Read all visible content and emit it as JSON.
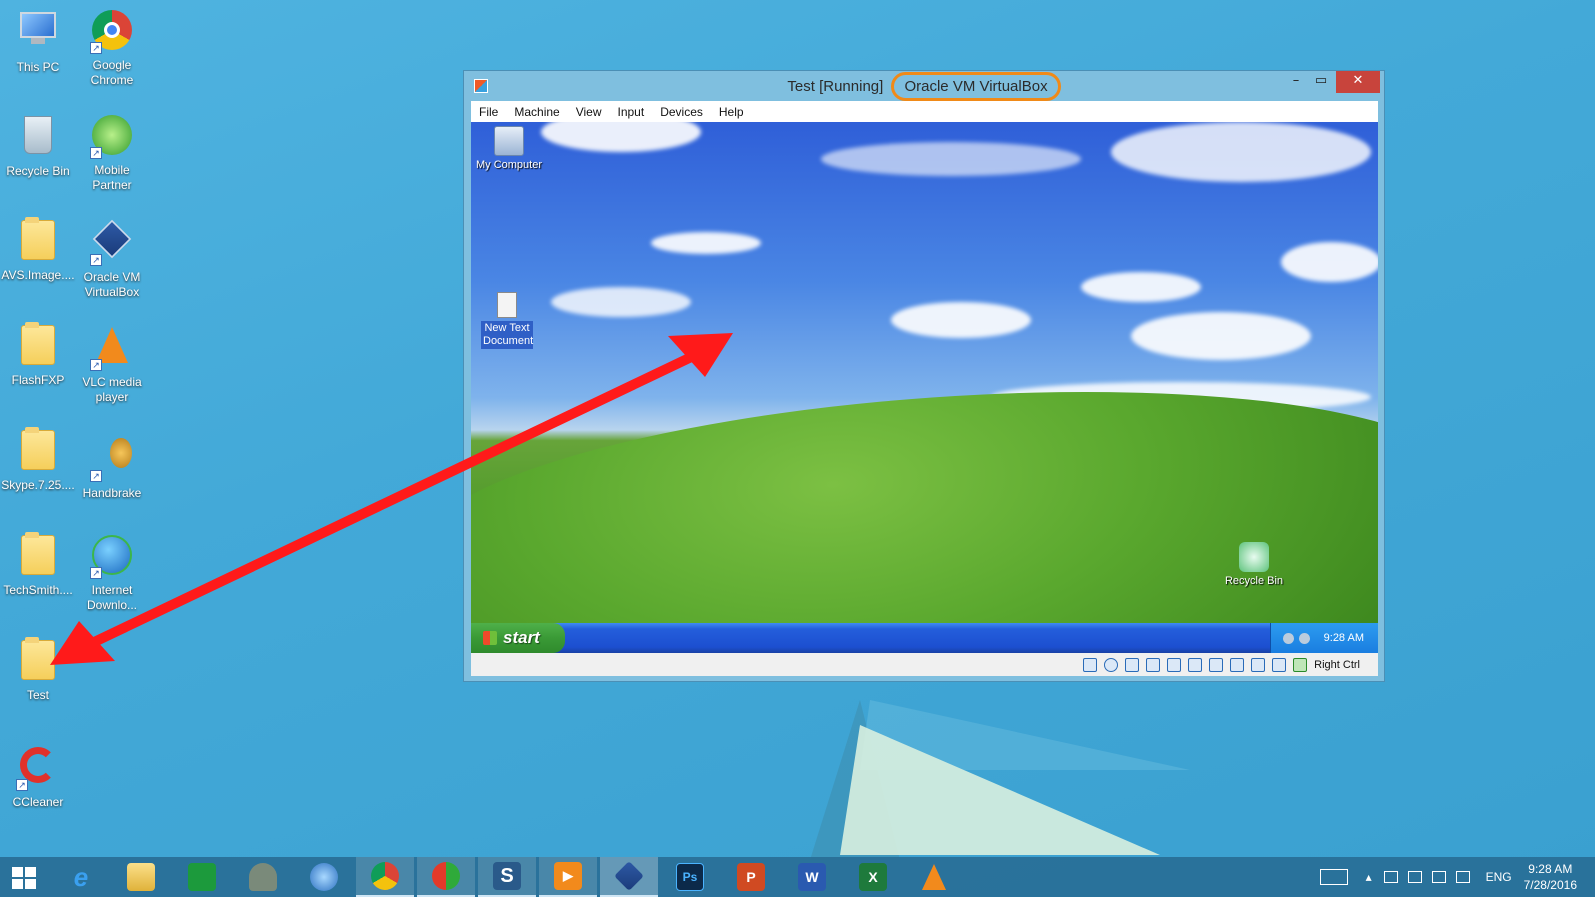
{
  "desktop": {
    "icons": [
      {
        "label": "This PC"
      },
      {
        "label": "Google Chrome"
      },
      {
        "label": "Recycle Bin"
      },
      {
        "label": "Mobile Partner"
      },
      {
        "label": "AVS.Image...."
      },
      {
        "label": "Oracle VM VirtualBox"
      },
      {
        "label": "FlashFXP"
      },
      {
        "label": "VLC media player"
      },
      {
        "label": "Skype.7.25...."
      },
      {
        "label": "Handbrake"
      },
      {
        "label": "TechSmith...."
      },
      {
        "label": "Internet Downlo..."
      },
      {
        "label": "Test"
      },
      {
        "label": "CCleaner"
      }
    ]
  },
  "vbox": {
    "title_prefix": "Test [Running]",
    "title_app": "Oracle VM VirtualBox",
    "window_buttons": {
      "minimize": "–",
      "maximize": "▭",
      "close": "✕"
    },
    "menu": [
      "File",
      "Machine",
      "View",
      "Input",
      "Devices",
      "Help"
    ],
    "host_key": "Right Ctrl"
  },
  "guest": {
    "icons": {
      "my_computer": "My Computer",
      "new_text_document": "New Text Document",
      "recycle_bin": "Recycle Bin"
    },
    "start_label": "start",
    "clock": "9:28 AM"
  },
  "taskbar": {
    "tray": {
      "language": "ENG",
      "time": "9:28 AM",
      "date": "7/28/2016",
      "show_hidden": "▴"
    },
    "apps": [
      {
        "name": "Internet Explorer",
        "glyph": "e"
      },
      {
        "name": "File Explorer",
        "glyph": ""
      },
      {
        "name": "Store",
        "glyph": ""
      },
      {
        "name": "Scanner",
        "glyph": ""
      },
      {
        "name": "Globe",
        "glyph": ""
      },
      {
        "name": "Google Chrome",
        "glyph": ""
      },
      {
        "name": "Greenshot",
        "glyph": ""
      },
      {
        "name": "Camtasia",
        "glyph": "S"
      },
      {
        "name": "Media Player",
        "glyph": "▶"
      },
      {
        "name": "VirtualBox",
        "glyph": ""
      },
      {
        "name": "Photoshop",
        "glyph": "Ps"
      },
      {
        "name": "PowerPoint",
        "glyph": "P"
      },
      {
        "name": "Word",
        "glyph": "W"
      },
      {
        "name": "Excel",
        "glyph": "X"
      },
      {
        "name": "VLC",
        "glyph": ""
      }
    ]
  },
  "colors": {
    "highlight_ring": "#f08a18",
    "arrow": "#ff1a1a",
    "close_button": "#c8443c"
  }
}
